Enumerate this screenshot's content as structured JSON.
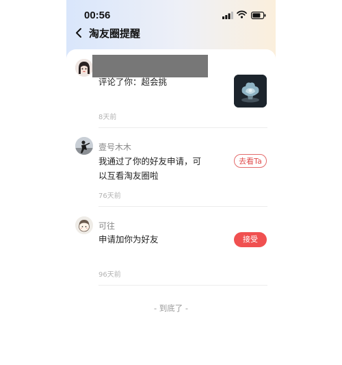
{
  "status_bar": {
    "time": "00:56"
  },
  "header": {
    "title": "淘友圈提醒"
  },
  "notifications": [
    {
      "user": "",
      "message": "评论了你：超会挑",
      "ago": "8天前"
    },
    {
      "user": "壹号木木",
      "message_line1": "我通过了你的好友申请，可",
      "message_line2": "以互看淘友圈啦",
      "ago": "76天前",
      "action": "去看Ta"
    },
    {
      "user": "可往",
      "message": "申请加你为好友",
      "ago": "96天前",
      "action": "接受"
    }
  ],
  "footer": {
    "end_text": "- 到底了 -"
  },
  "colors": {
    "accent": "#f05050",
    "accent_text": "#e04b4b",
    "divider": "#ececec"
  },
  "icons": [
    "signal-icon",
    "wifi-icon",
    "battery-icon",
    "back-arrow-icon"
  ]
}
